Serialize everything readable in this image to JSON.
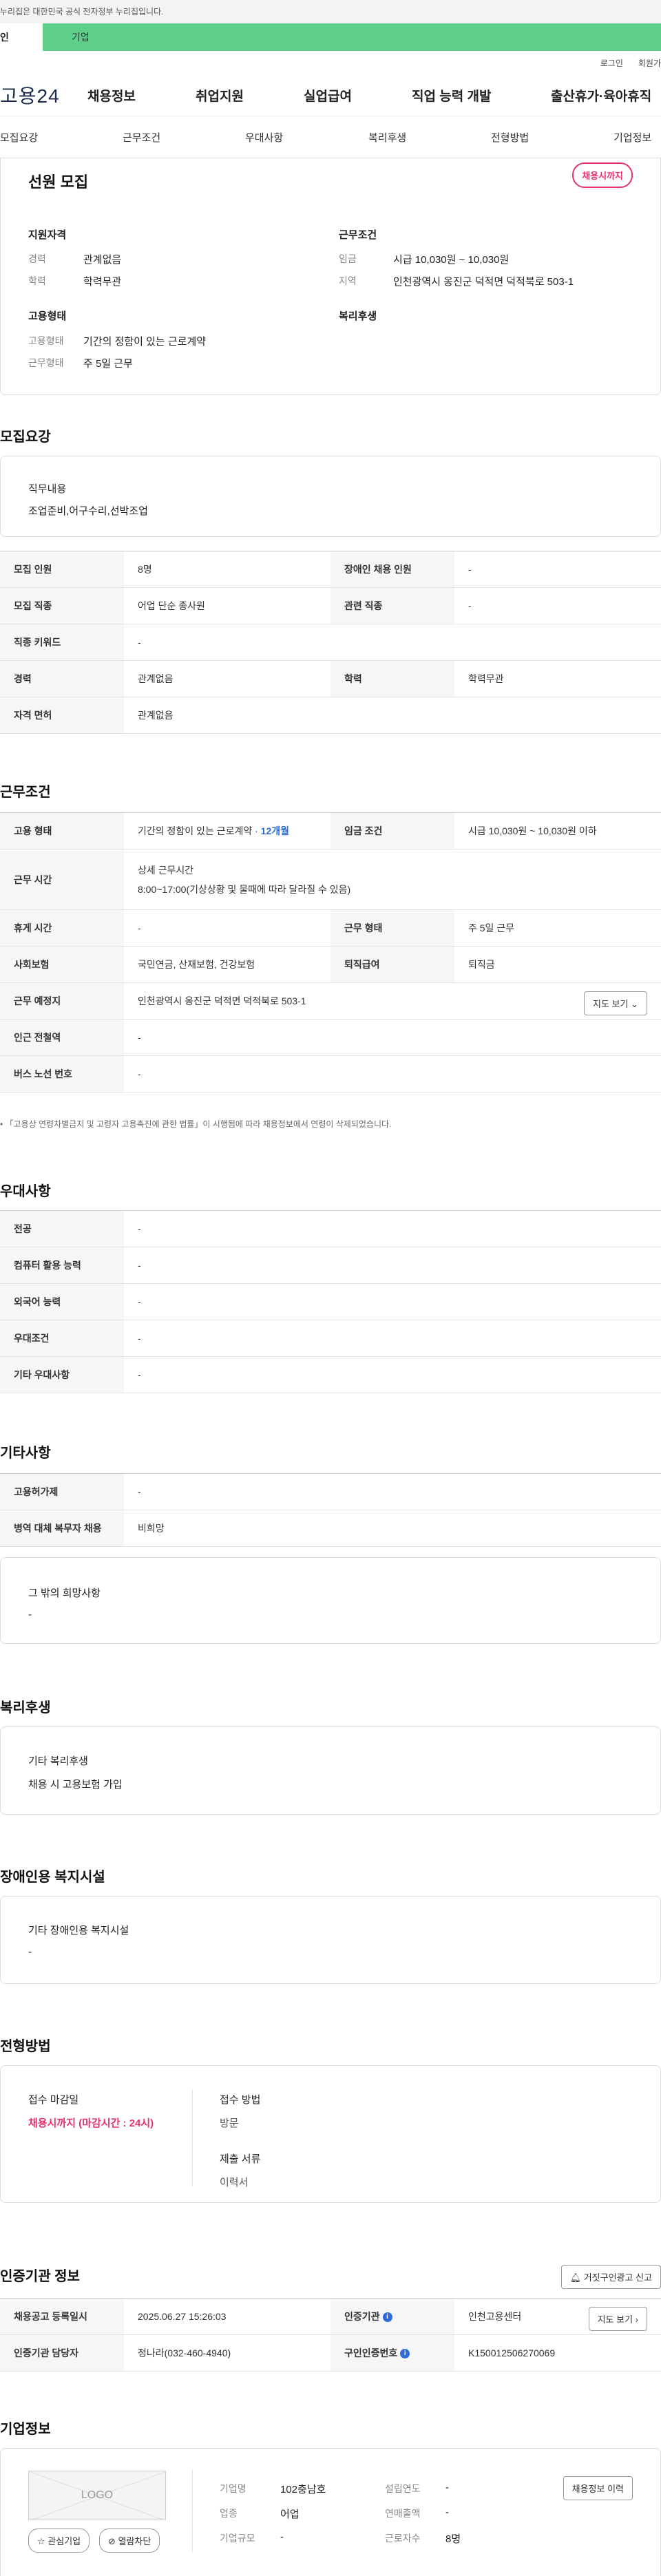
{
  "gov_banner": "누리집은 대한민국 공식 전자정부 누리집입니다.",
  "user_tabs": [
    "인",
    "기업"
  ],
  "util": {
    "login": "로그인",
    "signup": "회원가"
  },
  "brand": "고용24",
  "gnb": [
    "채용정보",
    "취업지원",
    "실업급여",
    "직업 능력 개발",
    "출산휴가·육아휴직"
  ],
  "subnav": [
    "모집요강",
    "근무조건",
    "우대사항",
    "복리후생",
    "전형방법",
    "기업정보"
  ],
  "summary": {
    "title": "선원 모집",
    "deadline_badge": "채용시까지",
    "qual_title": "지원자격",
    "qual": [
      {
        "label": "경력",
        "value": "관계없음"
      },
      {
        "label": "학력",
        "value": "학력무관"
      }
    ],
    "emp_title": "고용형태",
    "emp": [
      {
        "label": "고용형태",
        "value": "기간의 정함이 있는 근로계약"
      },
      {
        "label": "근무형태",
        "value": "주 5일 근무"
      }
    ],
    "cond_title": "근무조건",
    "cond": [
      {
        "label": "임금",
        "value": "시급 10,030원 ~ 10,030원"
      },
      {
        "label": "지역",
        "value": "인천광역시 옹진군 덕적면 덕적북로 503-1"
      }
    ],
    "welfare_title": "복리후생"
  },
  "recruit": {
    "title": "모집요강",
    "duty_title": "직무내용",
    "duty_value": "조업준비,어구수리,선박조업",
    "rows": [
      {
        "k1": "모집 인원",
        "v1": "8명",
        "k2": "장애인 채용 인원",
        "v2": "-"
      },
      {
        "k1": "모집 직종",
        "v1": "어업 단순 종사원",
        "k2": "관련 직종",
        "v2": "-"
      },
      {
        "k1": "직종 키워드",
        "v1": "-"
      },
      {
        "k1": "경력",
        "v1": "관계없음",
        "k2": "학력",
        "v2": "학력무관"
      },
      {
        "k1": "자격 면허",
        "v1": "관계없음"
      }
    ]
  },
  "conditions": {
    "title": "근무조건",
    "emp_type_label": "고용 형태",
    "emp_type_value": "기간의 정함이 있는 근로계약 · ",
    "emp_type_months": "12개월",
    "wage_label": "임금 조건",
    "wage_value": "시급 10,030원 ~ 10,030원 이하",
    "hours_label": "근무 시간",
    "hours_title": "상세 근무시간",
    "hours_value": "8:00~17:00(기상상황 및 물때에 따라 달라질 수 있음)",
    "rest_label": "휴게 시간",
    "rest_value": "-",
    "shift_label": "근무 형태",
    "shift_value": "주 5일 근무",
    "ins_label": "사회보험",
    "ins_value": "국민연금, 산재보험, 건강보험",
    "sev_label": "퇴직급여",
    "sev_value": "퇴직금",
    "place_label": "근무 예정지",
    "place_value": "인천광역시 옹진군 덕적면 덕적북로 503-1",
    "map_btn": "지도 보기",
    "subway_label": "인근 전철역",
    "subway_value": "-",
    "bus_label": "버스 노선 번호",
    "bus_value": "-",
    "note": "「고용상 연령차별금지 및 고령자 고용촉진에 관한 법률」이 시행됨에 따라 채용정보에서 연령이 삭제되었습니다."
  },
  "prefs": {
    "title": "우대사항",
    "rows": [
      {
        "k": "전공",
        "v": "-"
      },
      {
        "k": "컴퓨터 활용 능력",
        "v": "-"
      },
      {
        "k": "외국어 능력",
        "v": "-"
      },
      {
        "k": "우대조건",
        "v": "-"
      },
      {
        "k": "기타 우대사항",
        "v": "-"
      }
    ]
  },
  "etc": {
    "title": "기타사항",
    "rows": [
      {
        "k": "고용허가제",
        "v": "-"
      },
      {
        "k": "병역 대체 복무자 채용",
        "v": "비희망"
      }
    ],
    "wish_title": "그 밖의 희망사항",
    "wish_value": "-"
  },
  "welfare": {
    "title": "복리후생",
    "sub": "기타 복리후생",
    "value": "채용 시 고용보험 가입"
  },
  "facility": {
    "title": "장애인용 복지시설",
    "sub": "기타 장애인용 복지시설",
    "value": "-"
  },
  "process": {
    "title": "전형방법",
    "deadline_label": "접수 마감일",
    "deadline_value": "채용시까지 (마감시간 : 24시)",
    "method_label": "접수 방법",
    "method_value": "방문",
    "docs_label": "제출 서류",
    "docs_value": "이력서"
  },
  "agency": {
    "title": "인증기관 정보",
    "report_btn": "거짓구인광고 신고",
    "reg_label": "채용공고 등록일시",
    "reg_value": "2025.06.27 15:26:03",
    "org_label": "인증기관",
    "org_value": "인천고용센터",
    "map_btn": "지도 보기",
    "mgr_label": "인증기관 담당자",
    "mgr_value": "정나라(032-460-4940)",
    "id_label": "구인인증번호",
    "id_value": "K150012506270069"
  },
  "company": {
    "title": "기업정보",
    "logo": "LOGO",
    "fav_btn": "관심기업",
    "block_btn": "열람차단",
    "history_btn": "채용정보 이력",
    "fields": [
      {
        "label": "기업명",
        "value": "102충남호"
      },
      {
        "label": "업종",
        "value": "어업"
      },
      {
        "label": "기업규모",
        "value": "-"
      },
      {
        "label": "설립연도",
        "value": "-"
      },
      {
        "label": "연매출액",
        "value": "-"
      },
      {
        "label": "근로자수",
        "value": "8명"
      }
    ]
  },
  "colors": {
    "accent_green": "#5fd08c",
    "badge_pink": "#e6336b",
    "link_blue": "#2f6bd8"
  }
}
